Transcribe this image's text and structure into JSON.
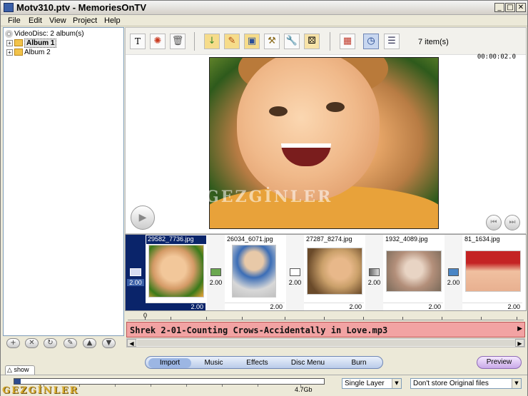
{
  "window": {
    "title": "Motv310.ptv - MemoriesOnTV",
    "minimize_label": "_",
    "maximize_label": "□",
    "close_label": "✕"
  },
  "menu": [
    "File",
    "Edit",
    "View",
    "Project",
    "Help"
  ],
  "tree": {
    "root": "VideoDisc: 2 album(s)",
    "albums": [
      {
        "label": "Album 1",
        "selected": true
      },
      {
        "label": "Album 2",
        "selected": false
      }
    ]
  },
  "tree_toolbar_icons": [
    "add-icon",
    "remove-icon",
    "rotate-icon",
    "edit-icon",
    "move-up-icon",
    "move-down-icon"
  ],
  "toolbar": {
    "icons": [
      "text-icon",
      "settings-icon",
      "trash-icon",
      "import-photo-icon",
      "photo-edit-icon",
      "photo-save-icon",
      "tools-icon",
      "wrench-icon",
      "dice-icon",
      "thumbnail-view-icon",
      "timeline-view-icon",
      "list-view-icon"
    ],
    "item_count": "7 item(s)"
  },
  "preview": {
    "timecode": "00:00:02.0",
    "watermark": "GEZGİNLER"
  },
  "filmstrip": {
    "start_duration": "2.00",
    "clips": [
      {
        "name": "29582_7736.jpg",
        "duration": "2.00",
        "selected": true,
        "colors": [
          "#f2c79a",
          "#3a7a1a"
        ]
      },
      {
        "name": "26034_6071.jpg",
        "duration": "2.00",
        "selected": false,
        "colors": [
          "#3b6db6",
          "#e8c9a8"
        ]
      },
      {
        "name": "27287_8274.jpg",
        "duration": "2.00",
        "selected": false,
        "colors": [
          "#caa06a",
          "#6a4a2a"
        ]
      },
      {
        "name": "1932_4089.jpg",
        "duration": "2.00",
        "selected": false,
        "colors": [
          "#e8d4c4",
          "#b38f7a"
        ]
      },
      {
        "name": "81_1634.jpg",
        "duration": "2.00",
        "selected": false,
        "colors": [
          "#c42424",
          "#f0c0a0"
        ]
      }
    ],
    "transitions": [
      {
        "duration": "2.00",
        "color": "#6aa84f"
      },
      {
        "duration": "2.00",
        "color": "#ffffff"
      },
      {
        "duration": "2.00",
        "color": "#666666"
      },
      {
        "duration": "2.00",
        "color": "#4a86c6"
      }
    ]
  },
  "timeline": {
    "ruler_start": "0",
    "music_track": "Shrek 2-01-Counting Crows-Accidentally in Love.mp3"
  },
  "tabs": [
    {
      "label": "Import",
      "active": true
    },
    {
      "label": "Music",
      "active": false
    },
    {
      "label": "Effects",
      "active": false
    },
    {
      "label": "Disc Menu",
      "active": false
    },
    {
      "label": "Burn",
      "active": false
    }
  ],
  "preview_button": "Preview",
  "show_tab": "show",
  "status": {
    "capacity_label": "4.7Gb",
    "capacity_used_fraction": 0.02,
    "layer_select": "Single Layer",
    "original_files_select": "Don't store Original files",
    "logo": "GEZGİNLER"
  },
  "colors": {
    "accent": "#0a246a",
    "music_track": "#f2a3a3",
    "preview_button": "#c9a9e8"
  }
}
